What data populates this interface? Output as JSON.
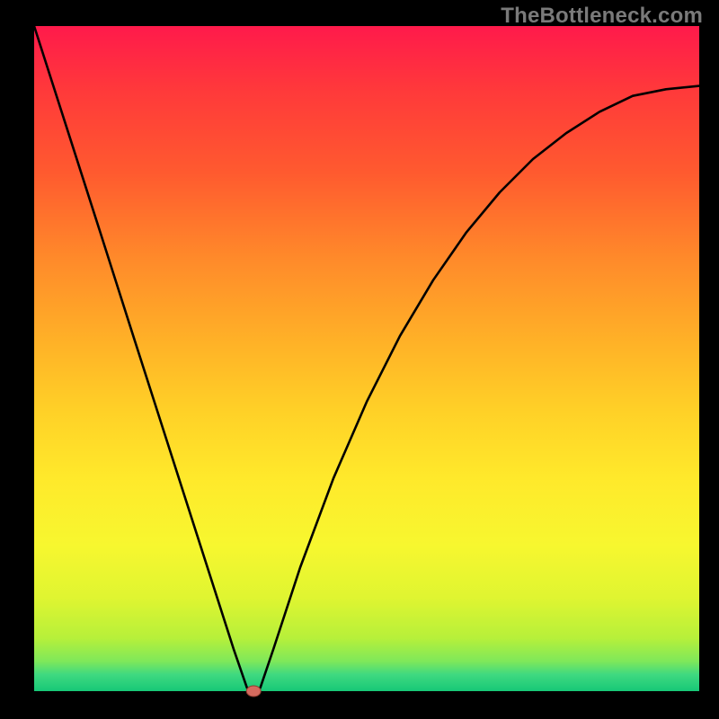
{
  "watermark": "TheBottleneck.com",
  "chart_data": {
    "type": "line",
    "title": "",
    "xlabel": "",
    "ylabel": "",
    "xlim": [
      0,
      100
    ],
    "ylim": [
      0,
      100
    ],
    "x": [
      0,
      5,
      10,
      15,
      20,
      25,
      30,
      32,
      33,
      34,
      36,
      40,
      45,
      50,
      55,
      60,
      65,
      70,
      75,
      80,
      85,
      90,
      95,
      100
    ],
    "values": [
      100,
      84.4,
      68.8,
      53.1,
      37.5,
      21.9,
      6.3,
      0.5,
      0,
      0.5,
      6.4,
      18.6,
      32.0,
      43.5,
      53.4,
      61.8,
      69.0,
      75.0,
      80.0,
      83.9,
      87.1,
      89.5,
      90.5,
      91.0
    ],
    "dip_point": {
      "x": 33,
      "y_percent": 0
    },
    "notes": "Background is a smooth vertical gradient from red (top) through orange and yellow to green (bottom). Curve dips to 0 near x≈33 with a small red marker at the minimum."
  },
  "plot_geometry": {
    "outer_width": 800,
    "outer_height": 800,
    "inner_left": 38,
    "inner_top": 29,
    "inner_width": 740,
    "inner_height": 740
  },
  "gradient_stops": [
    {
      "offset": 0.0,
      "color": "#ff1a4b"
    },
    {
      "offset": 0.1,
      "color": "#ff3a3a"
    },
    {
      "offset": 0.22,
      "color": "#ff5a2f"
    },
    {
      "offset": 0.35,
      "color": "#ff8a2a"
    },
    {
      "offset": 0.48,
      "color": "#ffb327"
    },
    {
      "offset": 0.58,
      "color": "#ffd127"
    },
    {
      "offset": 0.68,
      "color": "#ffe92b"
    },
    {
      "offset": 0.78,
      "color": "#f7f72f"
    },
    {
      "offset": 0.86,
      "color": "#dff531"
    },
    {
      "offset": 0.92,
      "color": "#b7f03a"
    },
    {
      "offset": 0.955,
      "color": "#7fe85a"
    },
    {
      "offset": 0.975,
      "color": "#3fd980"
    },
    {
      "offset": 1.0,
      "color": "#17c877"
    }
  ],
  "marker": {
    "color_fill": "#d46a5e",
    "color_stroke": "#8e3a2e",
    "rx": 8,
    "ry": 6
  },
  "curve_style": {
    "stroke": "#000000",
    "width": 2.6
  }
}
